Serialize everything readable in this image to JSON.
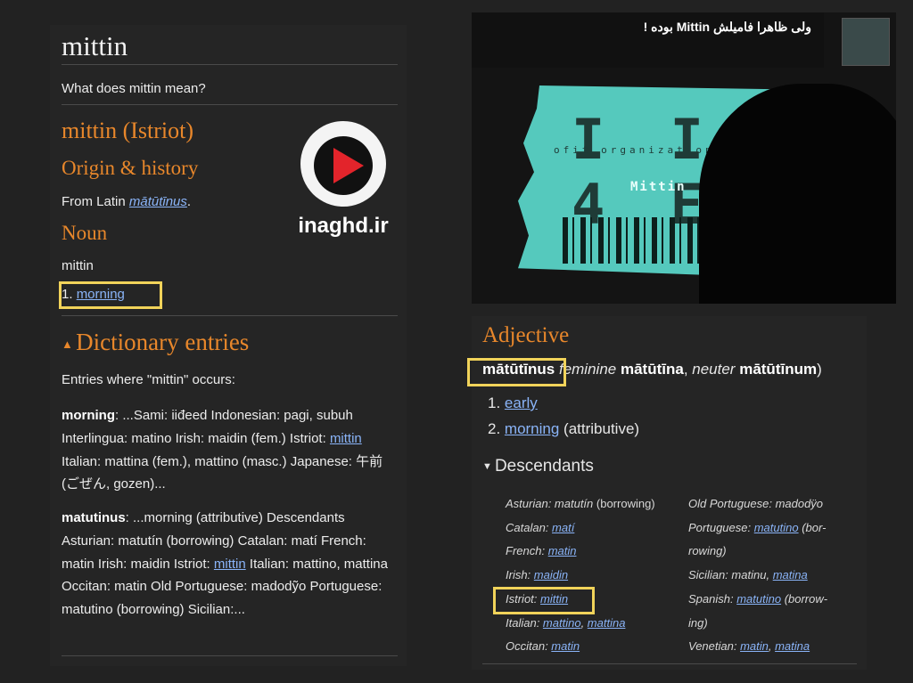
{
  "left": {
    "title": "mittin",
    "question": "What does mittin mean?",
    "entry_heading": "mittin (Istriot)",
    "origin_heading": "Origin & history",
    "origin_text_prefix": "From Latin ",
    "origin_link": "mātūtīnus",
    "origin_text_suffix": ".",
    "pos_heading": "Noun",
    "headword": "mittin",
    "sense_number": "1. ",
    "sense_link": "morning",
    "dict_heading": "Dictionary entries",
    "entries_intro": "Entries where \"mittin\" occurs:",
    "para1": {
      "bold": "morning",
      "text1": ": ...Sami: iiđeed Indonesian: pagi, subuh Interlingua: matino Irish: maidin (fem.) Istriot: ",
      "link": "mittin",
      "text2": " Italian: mattina (fem.), mattino (masc.) Japanese: 午前 (ごぜん, gozen)..."
    },
    "para2": {
      "bold": "matutinus",
      "text1": ": ...morning (attributive) Descendants Asturian: matutín (borrowing) Catalan: matí French: matin Irish: maidin Istriot: ",
      "link": "mittin",
      "text2": " Italian: mattino, mattina Occitan: matin Old Portuguese: madodỹo Portuguese: matutino (borrowing) Sicilian:..."
    }
  },
  "logo": {
    "text": "inaghd.ir"
  },
  "video": {
    "caption": "ولی ظاهرا فامیلش Mittin بوده !",
    "card_big": "I I 4 E",
    "card_small": "ofit organization",
    "card_name": "Mittin"
  },
  "right": {
    "pos_heading": "Adjective",
    "headword": "mātūtīnus",
    "fem_label": "feminine",
    "fem_form": "mātūtīna",
    "neut_label": "neuter",
    "neut_form": "mātūtīnum",
    "senses": [
      {
        "num": "1. ",
        "link": "early",
        "note": ""
      },
      {
        "num": "2. ",
        "link": "morning",
        "note": " (attributive)"
      }
    ],
    "descendants_heading": "Descendants",
    "desc_left": [
      {
        "lang": "Asturian: ",
        "word": "matutín",
        "note": " (borrowing)",
        "linked": false
      },
      {
        "lang": "Catalan: ",
        "word": "matí",
        "note": "",
        "linked": true
      },
      {
        "lang": "French: ",
        "word": "matin",
        "note": "",
        "linked": true
      },
      {
        "lang": "Irish: ",
        "word": "maidin",
        "note": "",
        "linked": true
      },
      {
        "lang": "Istriot: ",
        "word": "mittin",
        "note": "",
        "linked": true
      },
      {
        "lang": "Italian: ",
        "word": "mattino",
        "word2": "mattina",
        "note": "",
        "linked": true
      },
      {
        "lang": "Occitan: ",
        "word": "matin",
        "note": "",
        "linked": true
      }
    ],
    "desc_right": [
      {
        "lang": "Old Portuguese: ",
        "word": "madodÿo"
      },
      {
        "lang": "Portuguese: ",
        "word": "matutino",
        "note": " (bor-"
      },
      {
        "lang": "",
        "word": "",
        "note": "rowing)"
      },
      {
        "lang": "Sicilian: ",
        "word": "matinu",
        "word2": "matina"
      },
      {
        "lang": "Spanish: ",
        "word": "matutino",
        "note": " (borrow-"
      },
      {
        "lang": "",
        "word": "",
        "note": "ing)"
      },
      {
        "lang": "Venetian: ",
        "word": "matin",
        "word2": "matina"
      }
    ]
  },
  "colors": {
    "background": "#222222",
    "accent_orange": "#e8872b",
    "link": "#8ab4f8",
    "highlight": "#f1d35a"
  }
}
